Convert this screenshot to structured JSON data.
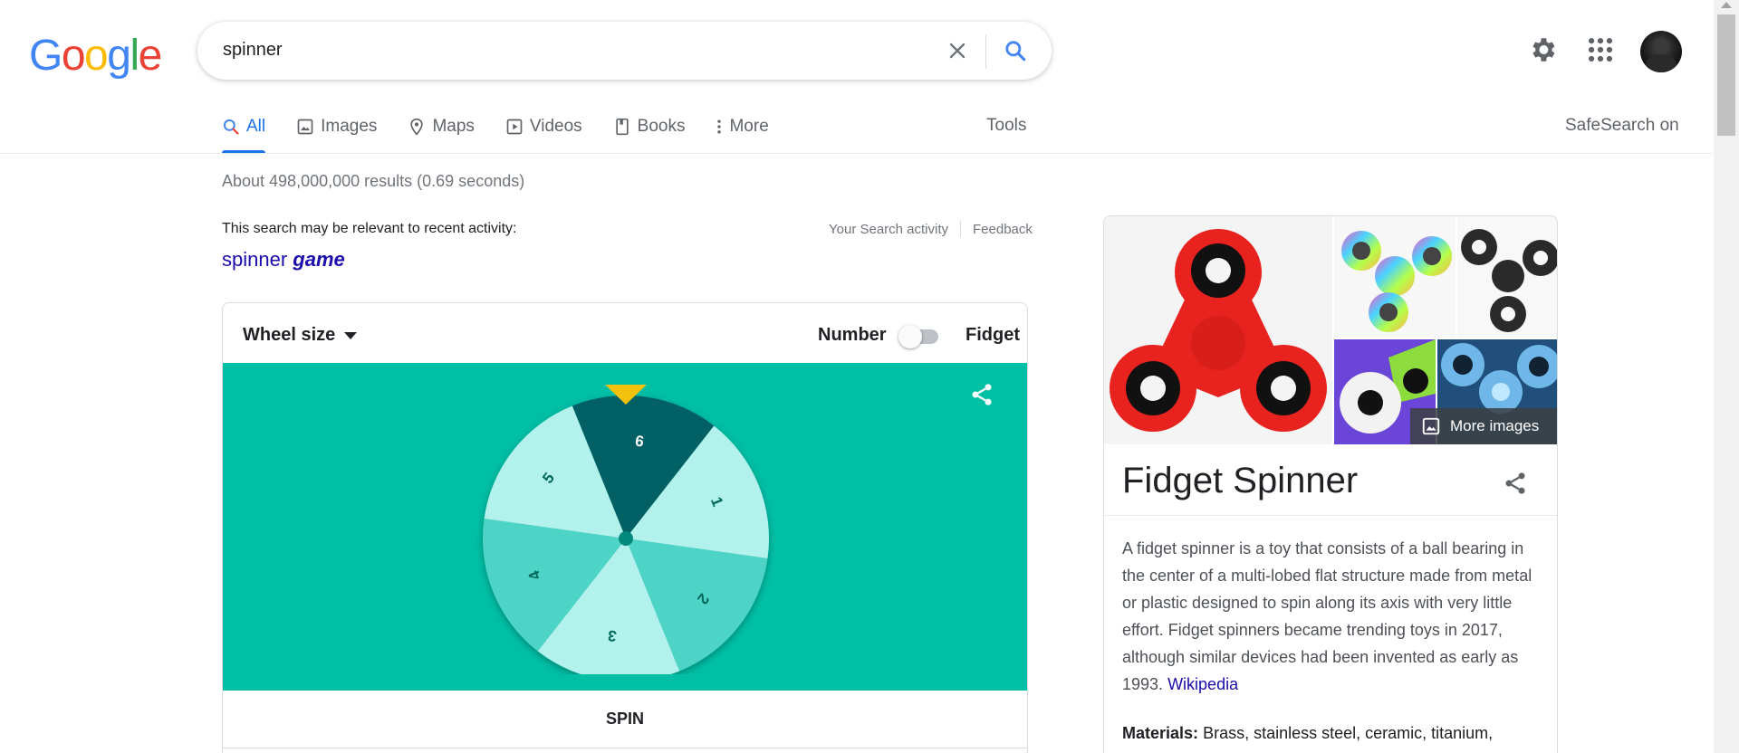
{
  "logo": {
    "text": "Google"
  },
  "search": {
    "query": "spinner"
  },
  "tabs": [
    {
      "label": "All",
      "icon": "search-icon"
    },
    {
      "label": "Images",
      "icon": "image-icon"
    },
    {
      "label": "Maps",
      "icon": "map-pin-icon"
    },
    {
      "label": "Videos",
      "icon": "play-icon"
    },
    {
      "label": "Books",
      "icon": "book-icon"
    },
    {
      "label": "More",
      "icon": "more-vert-icon"
    }
  ],
  "tools_label": "Tools",
  "safesearch_label": "SafeSearch on",
  "result_stats": "About 498,000,000 results (0.69 seconds)",
  "recent": {
    "note": "This search may be relevant to recent activity:",
    "link_prefix": "spinner",
    "link_bold": "game",
    "activity_link": "Your Search activity",
    "feedback_link": "Feedback"
  },
  "spinner_widget": {
    "wheel_size_label": "Wheel size",
    "number_label": "Number",
    "fidget_label": "Fidget",
    "toggle_on": false,
    "spin_label": "SPIN",
    "segments": [
      "6",
      "1",
      "2",
      "3",
      "4",
      "5"
    ],
    "colors": {
      "stage": "#00bfa5",
      "pointer": "#f4c20d"
    }
  },
  "knowledge_panel": {
    "title": "Fidget Spinner",
    "more_images_label": "More images",
    "description": "A fidget spinner is a toy that consists of a ball bearing in the center of a multi-lobed flat structure made from metal or plastic designed to spin along its axis with very little effort. Fidget spinners became trending toys in 2017, although similar devices had been invented as early as 1993.",
    "source_link": "Wikipedia",
    "materials_label": "Materials:",
    "materials_value": "Brass, stainless steel, ceramic, titanium,"
  }
}
